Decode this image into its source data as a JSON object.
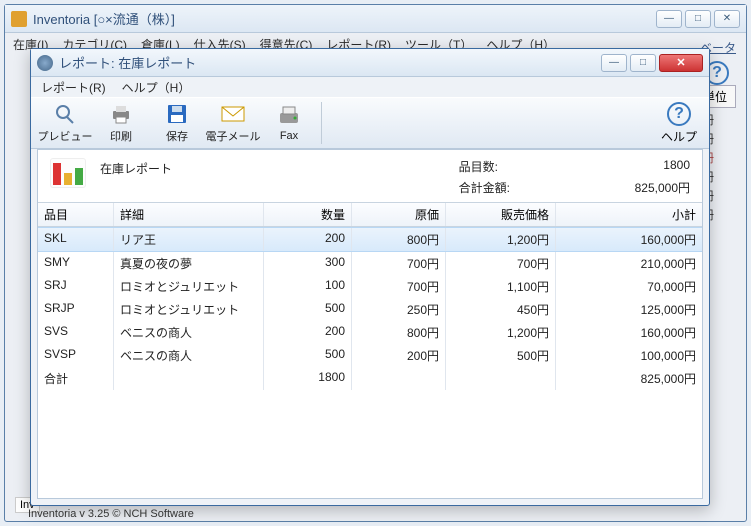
{
  "main": {
    "title": "Inventoria [○×流通（株）]",
    "menu": [
      "在庫(I)",
      "カテゴリ(C)",
      "倉庫(L)",
      "仕入先(S)",
      "得意先(C)",
      "レポート(R)",
      "ツール（T）",
      "ヘルプ（H）"
    ],
    "beta": "ベータ",
    "help_label": "ヘルプ",
    "right_header": "単位",
    "right_cells": [
      "冊",
      "冊",
      "冊",
      "冊",
      "冊",
      "冊"
    ],
    "inv_label": "Inv",
    "copyright": "Inventoria v 3.25 © NCH Software"
  },
  "report": {
    "title": "レポート: 在庫レポート",
    "menu": [
      "レポート(R)",
      "ヘルプ（H）"
    ],
    "tools": {
      "preview": "プレビュー",
      "print": "印刷",
      "save": "保存",
      "email": "電子メール",
      "fax": "Fax",
      "help": "ヘルプ"
    },
    "summary": {
      "title": "在庫レポート",
      "count_label": "品目数:",
      "count_value": "1800",
      "total_label": "合計金額:",
      "total_value": "825,000円"
    },
    "columns": {
      "code": "品目",
      "desc": "詳細",
      "qty": "数量",
      "cost": "原価",
      "price": "販売価格",
      "sub": "小計"
    },
    "rows": [
      {
        "code": "SKL",
        "desc": "リア王",
        "qty": "200",
        "cost": "800円",
        "price": "1,200円",
        "sub": "160,000円",
        "selected": true
      },
      {
        "code": "SMY",
        "desc": "真夏の夜の夢",
        "qty": "300",
        "cost": "700円",
        "price": "700円",
        "sub": "210,000円"
      },
      {
        "code": "SRJ",
        "desc": "ロミオとジュリエット",
        "qty": "100",
        "cost": "700円",
        "price": "1,100円",
        "sub": "70,000円"
      },
      {
        "code": "SRJP",
        "desc": "ロミオとジュリエット",
        "qty": "500",
        "cost": "250円",
        "price": "450円",
        "sub": "125,000円"
      },
      {
        "code": "SVS",
        "desc": "ベニスの商人",
        "qty": "200",
        "cost": "800円",
        "price": "1,200円",
        "sub": "160,000円"
      },
      {
        "code": "SVSP",
        "desc": "ベニスの商人",
        "qty": "500",
        "cost": "200円",
        "price": "500円",
        "sub": "100,000円"
      }
    ],
    "total": {
      "label": "合計",
      "qty": "1800",
      "sub": "825,000円"
    }
  }
}
